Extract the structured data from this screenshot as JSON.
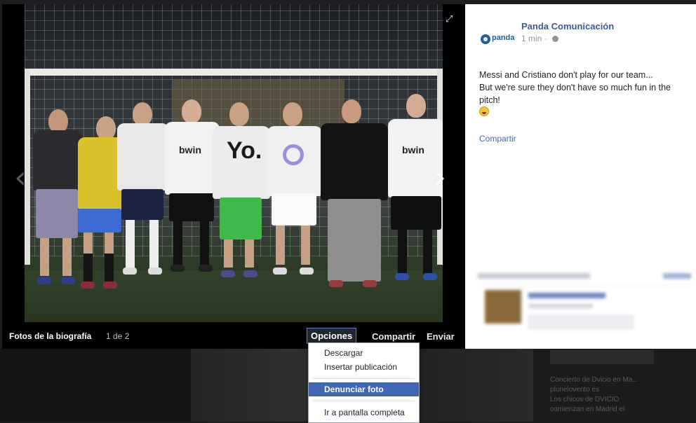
{
  "lightbox": {
    "album_title": "Fotos de la biografía",
    "photo_count": "1 de 2",
    "actions": {
      "options": "Opciones",
      "share": "Compartir",
      "send": "Enviar"
    },
    "shirts": {
      "sponsor": "bwin",
      "yo": "Yo."
    }
  },
  "post": {
    "page_name": "Panda Comunicación",
    "avatar_text": "panda",
    "time": "1 min",
    "text_lines": [
      "Messi and Cristiano don't play for our team...",
      "But we're sure they don't have so much fun in the pitch!"
    ],
    "share_link": "Compartir"
  },
  "options_menu": {
    "items": [
      "Descargar",
      "Insertar publicación",
      "Denunciar foto",
      "Ir a pantalla completa"
    ],
    "active_item": "Denunciar foto"
  },
  "background_feed": {
    "lines": [
      "Concierto de Dvicio en Ma...",
      "plunelovento es",
      "Los chicos de DVICIO",
      "comienzan en Madrid el"
    ]
  },
  "icons": {
    "expand": "expand-icon",
    "prev": "chevron-left-icon",
    "next": "chevron-right-icon",
    "globe": "globe-icon",
    "emoji": "smile-emoji-icon"
  },
  "colors": {
    "link": "#3b5998",
    "menu_active": "#4267b2",
    "stage": "#000000"
  }
}
